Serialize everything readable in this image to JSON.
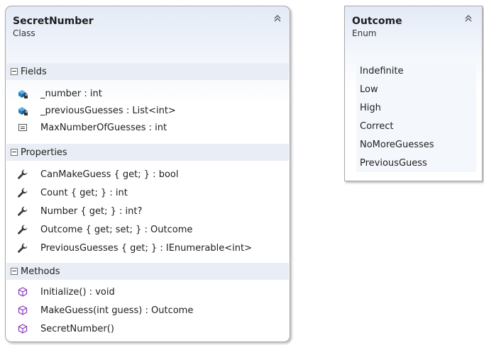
{
  "class_shape": {
    "name": "SecretNumber",
    "stereotype": "Class",
    "collapse_glyph": "»",
    "sections": [
      {
        "label": "Fields",
        "members": [
          {
            "text": "_number : int",
            "icon": "private-field-icon"
          },
          {
            "text": "_previousGuesses : List<int>",
            "icon": "private-field-icon"
          },
          {
            "text": "MaxNumberOfGuesses : int",
            "icon": "constant-icon"
          }
        ]
      },
      {
        "label": "Properties",
        "members": [
          {
            "text": "CanMakeGuess { get; } : bool",
            "icon": "property-wrench-icon"
          },
          {
            "text": "Count { get; } : int",
            "icon": "property-wrench-icon"
          },
          {
            "text": "Number { get; } : int?",
            "icon": "property-wrench-icon"
          },
          {
            "text": "Outcome { get; set; } : Outcome",
            "icon": "property-wrench-icon"
          },
          {
            "text": "PreviousGuesses { get; } : IEnumerable<int>",
            "icon": "property-wrench-icon"
          }
        ]
      },
      {
        "label": "Methods",
        "members": [
          {
            "text": "Initialize() : void",
            "icon": "method-cube-icon"
          },
          {
            "text": "MakeGuess(int guess) : Outcome",
            "icon": "method-cube-icon"
          },
          {
            "text": "SecretNumber()",
            "icon": "method-cube-icon"
          }
        ]
      }
    ]
  },
  "enum_shape": {
    "name": "Outcome",
    "stereotype": "Enum",
    "collapse_glyph": "»",
    "values": [
      "Indefinite",
      "Low",
      "High",
      "Correct",
      "NoMoreGuesses",
      "PreviousGuess"
    ]
  },
  "colors": {
    "section_bg": "#e9eef6",
    "header_gradient": "#e3eaf7",
    "border": "#a8a8a8",
    "field_icon": "#1f7fc4",
    "method_icon": "#8a3ab9"
  }
}
